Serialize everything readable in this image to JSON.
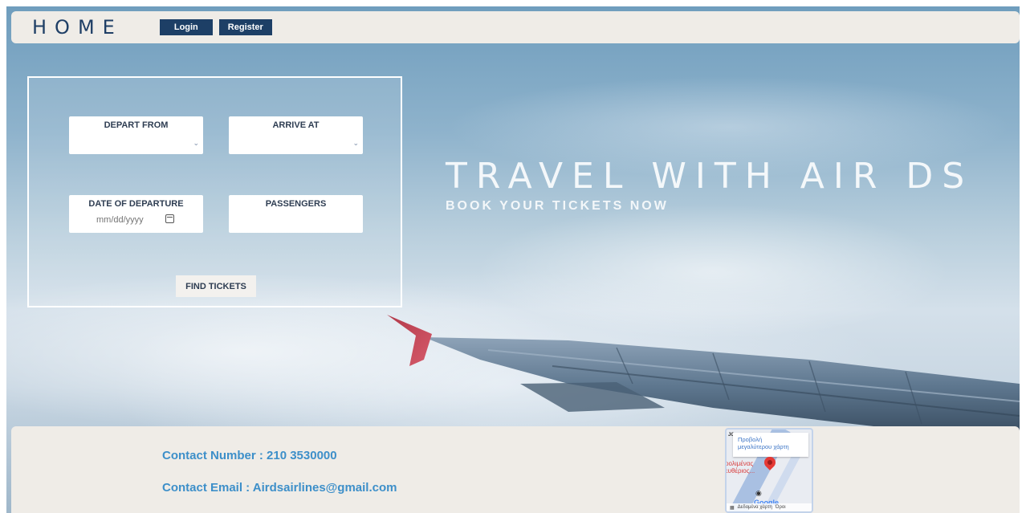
{
  "header": {
    "logo": "HOME",
    "login_label": "Login",
    "register_label": "Register"
  },
  "booking": {
    "depart_label": "DEPART FROM",
    "arrive_label": "ARRIVE AT",
    "date_label": "DATE OF DEPARTURE",
    "date_placeholder": "mm/dd/yyyy",
    "passengers_label": "PASSENGERS",
    "find_label": "FIND TICKETS"
  },
  "hero": {
    "title": "TRAVEL WITH AIR DS",
    "subtitle": "BOOK YOUR TICKETS NOW"
  },
  "footer": {
    "phone": "Contact Number : 210 3530000",
    "email": "Contact Email : Airdsairlines@gmail.com",
    "map": {
      "popup_line1": "Προβολή",
      "popup_line2": "μεγαλύτερου χάρτη",
      "place_line1": "ρολιμένας",
      "place_line2": "ευθέριος...",
      "corner": "JC",
      "google": "Google",
      "data_label": "Δεδομένα χάρτη",
      "terms_label": "Όροι"
    }
  },
  "colors": {
    "brand_navy": "#1d3f66",
    "contact_blue": "#3d8fc9",
    "panel_beige": "#efece7"
  }
}
